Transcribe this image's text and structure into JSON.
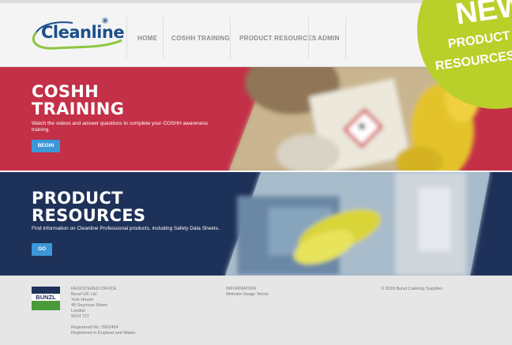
{
  "header": {
    "logo_text": "Cleanline",
    "nav": [
      {
        "label": "HOME"
      },
      {
        "label": "COSHH TRAINING"
      },
      {
        "label": "PRODUCT RESOURCES"
      },
      {
        "label": "ADMIN"
      }
    ]
  },
  "badge": {
    "line1": "NEW",
    "line2": "PRODUCT",
    "line3": "RESOURCES"
  },
  "coshh": {
    "title_line1": "COSHH",
    "title_line2": "TRAINING",
    "description": "Watch the videos and answer questions to complete your COSHH awareness training.",
    "button": "BEGIN"
  },
  "product": {
    "title_line1": "PRODUCT",
    "title_line2": "RESOURCES",
    "description": "Find information on Cleanline Professional products, including Safety Data Sheets.",
    "button": "GO"
  },
  "footer": {
    "logo_text": "BUNZL",
    "office": {
      "heading": "REGISTERED OFFICE",
      "lines": [
        "Bunzl UK Ltd",
        "York House",
        "45 Seymour Street",
        "London",
        "W1H 7JT"
      ],
      "reg_no": "Registered No: 2902454",
      "reg_place": "Registered in England and Wales"
    },
    "information": {
      "heading": "INFORMATION",
      "link": "Website Usage Terms"
    },
    "copyright": "© 2018 Bunzl Catering Supplies"
  },
  "colors": {
    "coshh_band": "#c33047",
    "product_band": "#1e3159",
    "button": "#3c97d8",
    "badge": "#b9cf2a",
    "logo_blue": "#1b4f8c",
    "logo_green": "#8dc63f"
  }
}
